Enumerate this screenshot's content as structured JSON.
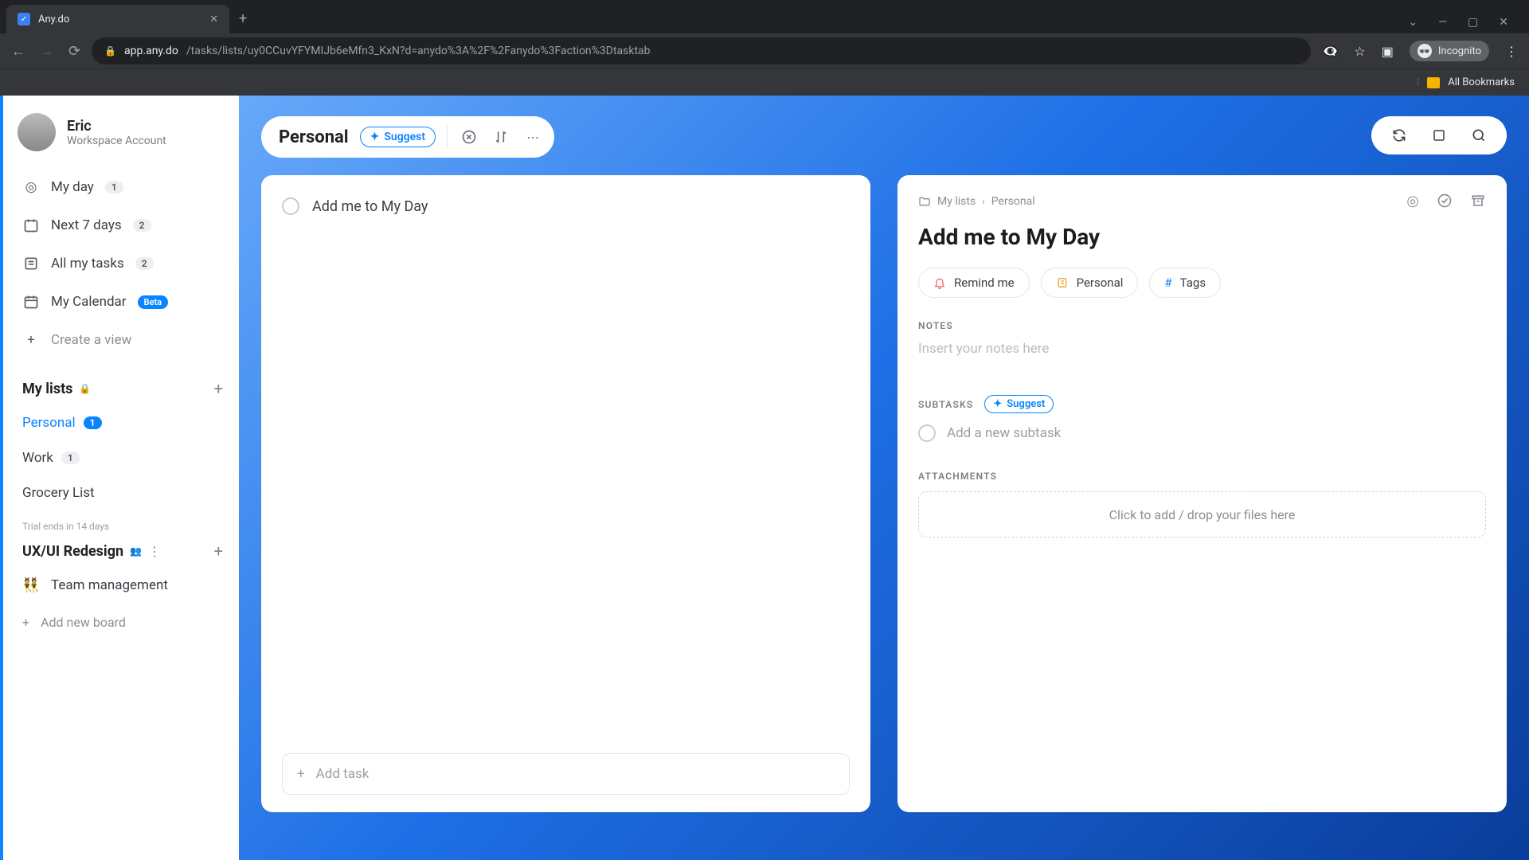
{
  "browser": {
    "tab_title": "Any.do",
    "url_domain": "app.any.do",
    "url_path": "/tasks/lists/uy0CCuvYFYMIJb6eMfn3_KxN?d=anydo%3A%2F%2Fanydo%3Faction%3Dtasktab",
    "incognito_label": "Incognito",
    "bookmarks_label": "All Bookmarks"
  },
  "sidebar": {
    "user_name": "Eric",
    "user_sub": "Workspace Account",
    "items": [
      {
        "label": "My day",
        "count": "1"
      },
      {
        "label": "Next 7 days",
        "count": "2"
      },
      {
        "label": "All my tasks",
        "count": "2"
      },
      {
        "label": "My Calendar",
        "badge": "Beta"
      }
    ],
    "create_view": "Create a view",
    "my_lists_title": "My lists",
    "lists": [
      {
        "label": "Personal",
        "count": "1",
        "active": true
      },
      {
        "label": "Work",
        "count": "1"
      },
      {
        "label": "Grocery List"
      }
    ],
    "trial_text": "Trial ends in 14 days",
    "workspace_title": "UX/UI Redesign",
    "team_mgmt": "Team management",
    "add_board": "Add new board"
  },
  "header": {
    "title": "Personal",
    "suggest": "Suggest"
  },
  "task_list": {
    "task1": "Add me to My Day",
    "add_task_placeholder": "Add task"
  },
  "detail": {
    "crumb1": "My lists",
    "crumb2": "Personal",
    "title": "Add me to My Day",
    "chip_remind": "Remind me",
    "chip_list": "Personal",
    "chip_tags": "Tags",
    "notes_label": "NOTES",
    "notes_placeholder": "Insert your notes here",
    "subtasks_label": "SUBTASKS",
    "subtasks_suggest": "Suggest",
    "subtask_placeholder": "Add a new subtask",
    "attachments_label": "ATTACHMENTS",
    "attach_placeholder": "Click to add / drop your files here"
  }
}
